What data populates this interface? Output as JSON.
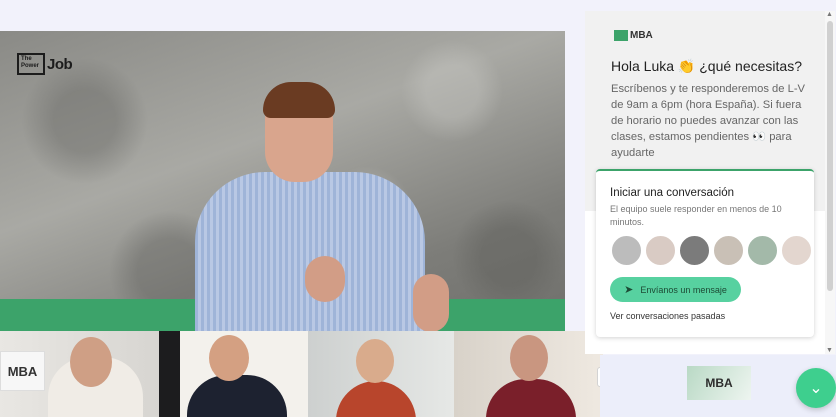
{
  "video": {
    "logo_box": "The Power",
    "logo_word": "Job",
    "thumb_logo": "MBA"
  },
  "chat": {
    "brand": "MBA",
    "greeting": "Hola Luka 👏 ¿qué necesitas?",
    "intro": "Escríbenos y te responderemos de L-V de 9am a 6pm (hora España). Si fuera de horario no puedes avanzar con las clases, estamos pendientes 👀 para ayudarte",
    "card": {
      "title": "Iniciar una conversación",
      "subtitle": "El equipo suele responder en menos de 10 minutos.",
      "send_label": "Envíanos un mensaje",
      "past_label": "Ver conversaciones pasadas"
    }
  },
  "sidebar_thumb": "MBA",
  "colors": {
    "brand_green": "#3ca36a",
    "button_green": "#57d1a0",
    "fab_green": "#3ecf8e"
  },
  "icons": {
    "send": "send-icon",
    "fab": "chevron-down-icon",
    "pip": "picture-in-picture-icon"
  }
}
